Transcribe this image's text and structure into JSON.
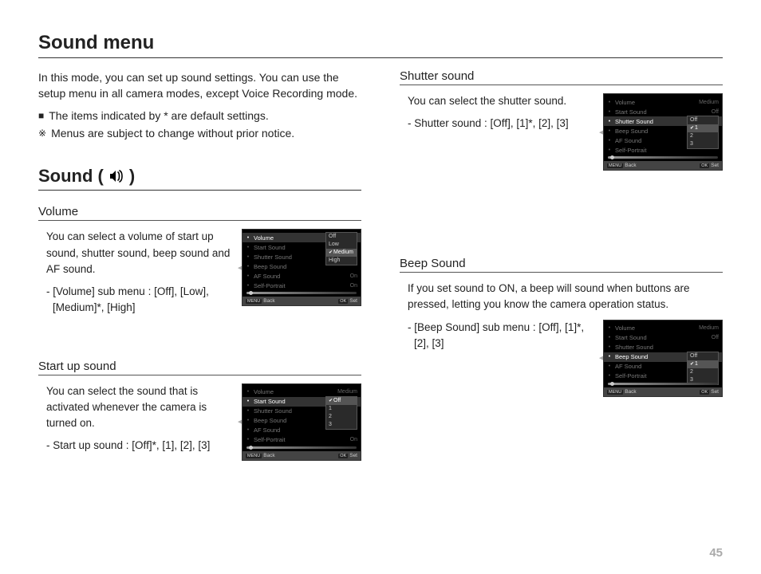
{
  "page": {
    "title": "Sound menu",
    "intro": "In this mode, you can set up sound settings. You can use the setup menu in all camera modes, except Voice Recording mode.",
    "note1_symbol": "■",
    "note1": "The items indicated by * are default settings.",
    "note2_symbol": "※",
    "note2": "Menus are subject to change without prior notice.",
    "sound_heading_prefix": "Sound (",
    "sound_heading_suffix": ")",
    "pagenum": "45"
  },
  "volume": {
    "heading": "Volume",
    "desc": "You can select a volume of start up sound, shutter sound, beep sound and AF sound.",
    "sub": "-  [Volume] sub menu : [Off], [Low], [Medium]*, [High]"
  },
  "startup": {
    "heading": "Start up sound",
    "desc": "You can select the sound that is activated whenever the camera is turned on.",
    "sub": "- Start up sound : [Off]*, [1], [2], [3]"
  },
  "shutter": {
    "heading": "Shutter sound",
    "desc": "You can select the shutter sound.",
    "sub": "- Shutter sound : [Off], [1]*, [2], [3]"
  },
  "beep": {
    "heading": "Beep Sound",
    "desc": "If you set sound to ON, a beep will sound when buttons are pressed, letting you know the camera operation status.",
    "sub": "- [Beep Sound] sub menu : [Off], [1]*, [2], [3]"
  },
  "menu": {
    "items": [
      "Volume",
      "Start Sound",
      "Shutter Sound",
      "Beep Sound",
      "AF Sound",
      "Self-Portrait"
    ],
    "val_medium": "Medium",
    "val_off": "Off",
    "val_on": "On",
    "back": "Back",
    "set": "Set",
    "menu_btn": "MENU",
    "ok_btn": "OK"
  },
  "popup_volume": {
    "items": [
      "Off",
      "Low",
      "Medium",
      "High"
    ],
    "sel": "Medium"
  },
  "popup_off123": {
    "items": [
      "Off",
      "1",
      "2",
      "3"
    ]
  },
  "popup_startup_sel": "Off",
  "popup_shutter_sel": "1",
  "popup_beep_sel": "1"
}
